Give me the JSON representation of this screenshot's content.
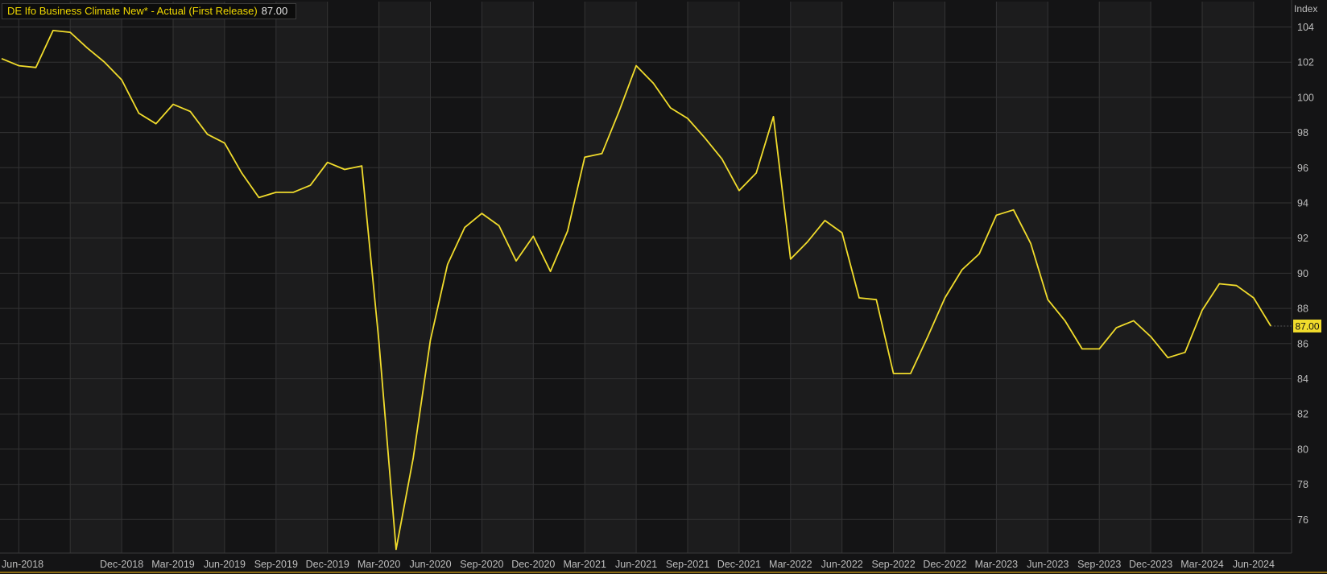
{
  "legend": {
    "label": "DE Ifo Business Climate New* - Actual (First Release)",
    "value": "87.00"
  },
  "last_value_badge": "87.00",
  "colors": {
    "background": "#141415",
    "band_alt": "#1c1c1d",
    "grid": "#333334",
    "line": "#f1dc2c",
    "axis_text": "#bdbdbd",
    "badge_bg": "#f1dc2c"
  },
  "chart_data": {
    "type": "line",
    "title": "",
    "xlabel": "",
    "ylabel": "Index",
    "ylim": [
      74.5,
      105.5
    ],
    "y_ticks": [
      76,
      78,
      80,
      82,
      84,
      86,
      88,
      90,
      92,
      94,
      96,
      98,
      100,
      102,
      104
    ],
    "x_ticks": [
      "Jun-2018",
      "Dec-2018",
      "Mar-2019",
      "Jun-2019",
      "Sep-2019",
      "Dec-2019",
      "Mar-2020",
      "Jun-2020",
      "Sep-2020",
      "Dec-2020",
      "Mar-2021",
      "Jun-2021",
      "Sep-2021",
      "Dec-2021",
      "Mar-2022",
      "Jun-2022",
      "Sep-2022",
      "Dec-2022",
      "Mar-2023",
      "Jun-2023",
      "Sep-2023",
      "Dec-2023",
      "Mar-2024",
      "Jun-2024"
    ],
    "grid": true,
    "series": [
      {
        "name": "DE Ifo Business Climate New* - Actual (First Release)",
        "x": [
          "2018-05",
          "2018-06",
          "2018-07",
          "2018-08",
          "2018-09",
          "2018-10",
          "2018-11",
          "2018-12",
          "2019-01",
          "2019-02",
          "2019-03",
          "2019-04",
          "2019-05",
          "2019-06",
          "2019-07",
          "2019-08",
          "2019-09",
          "2019-10",
          "2019-11",
          "2019-12",
          "2020-01",
          "2020-02",
          "2020-03",
          "2020-04",
          "2020-05",
          "2020-06",
          "2020-07",
          "2020-08",
          "2020-09",
          "2020-10",
          "2020-11",
          "2020-12",
          "2021-01",
          "2021-02",
          "2021-03",
          "2021-04",
          "2021-05",
          "2021-06",
          "2021-07",
          "2021-08",
          "2021-09",
          "2021-10",
          "2021-11",
          "2021-12",
          "2022-01",
          "2022-02",
          "2022-03",
          "2022-04",
          "2022-05",
          "2022-06",
          "2022-07",
          "2022-08",
          "2022-09",
          "2022-10",
          "2022-11",
          "2022-12",
          "2023-01",
          "2023-02",
          "2023-03",
          "2023-04",
          "2023-05",
          "2023-06",
          "2023-07",
          "2023-08",
          "2023-09",
          "2023-10",
          "2023-11",
          "2023-12",
          "2024-01",
          "2024-02",
          "2024-03",
          "2024-04",
          "2024-05",
          "2024-06",
          "2024-07"
        ],
        "values": [
          102.2,
          101.8,
          101.7,
          103.8,
          103.7,
          102.8,
          102.0,
          101.0,
          99.1,
          98.5,
          99.6,
          99.2,
          97.9,
          97.4,
          95.7,
          94.3,
          94.6,
          94.6,
          95.0,
          96.3,
          95.9,
          96.1,
          86.1,
          74.3,
          79.5,
          86.2,
          90.5,
          92.6,
          93.4,
          92.7,
          90.7,
          92.1,
          90.1,
          92.4,
          96.6,
          96.8,
          99.2,
          101.8,
          100.8,
          99.4,
          98.8,
          97.7,
          96.5,
          94.7,
          95.7,
          98.9,
          90.8,
          91.8,
          93.0,
          92.3,
          88.6,
          88.5,
          84.3,
          84.3,
          86.4,
          88.6,
          90.2,
          91.1,
          93.3,
          93.6,
          91.7,
          88.5,
          87.3,
          85.7,
          85.7,
          86.9,
          87.3,
          86.4,
          85.2,
          85.5,
          87.9,
          89.4,
          89.3,
          88.6,
          87.0
        ]
      }
    ]
  }
}
